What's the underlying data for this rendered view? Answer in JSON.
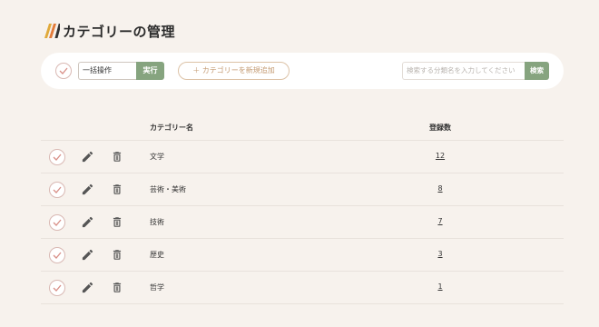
{
  "page": {
    "title": "カテゴリーの管理"
  },
  "toolbar": {
    "bulk_action_value": "一括操作",
    "execute_label": "実行",
    "add_category_label": "＋ カテゴリーを新規追加",
    "search_placeholder": "検索する分類名を入力してください",
    "search_label": "検索"
  },
  "table": {
    "columns": {
      "name": "カテゴリー名",
      "count": "登録数"
    },
    "rows": [
      {
        "name": "文学",
        "count": "12"
      },
      {
        "name": "芸術・美術",
        "count": "8"
      },
      {
        "name": "技術",
        "count": "7"
      },
      {
        "name": "歴史",
        "count": "3"
      },
      {
        "name": "哲学",
        "count": "1"
      }
    ]
  },
  "colors": {
    "background": "#f7f2ed",
    "accent_green": "#86a47f",
    "accent_tan": "#c49b73",
    "check_pink": "#d9b8b3"
  },
  "icons": {
    "logo": "stripes-logo",
    "checkbox": "check-circle-icon",
    "edit": "pencil-icon",
    "delete": "trash-icon"
  }
}
